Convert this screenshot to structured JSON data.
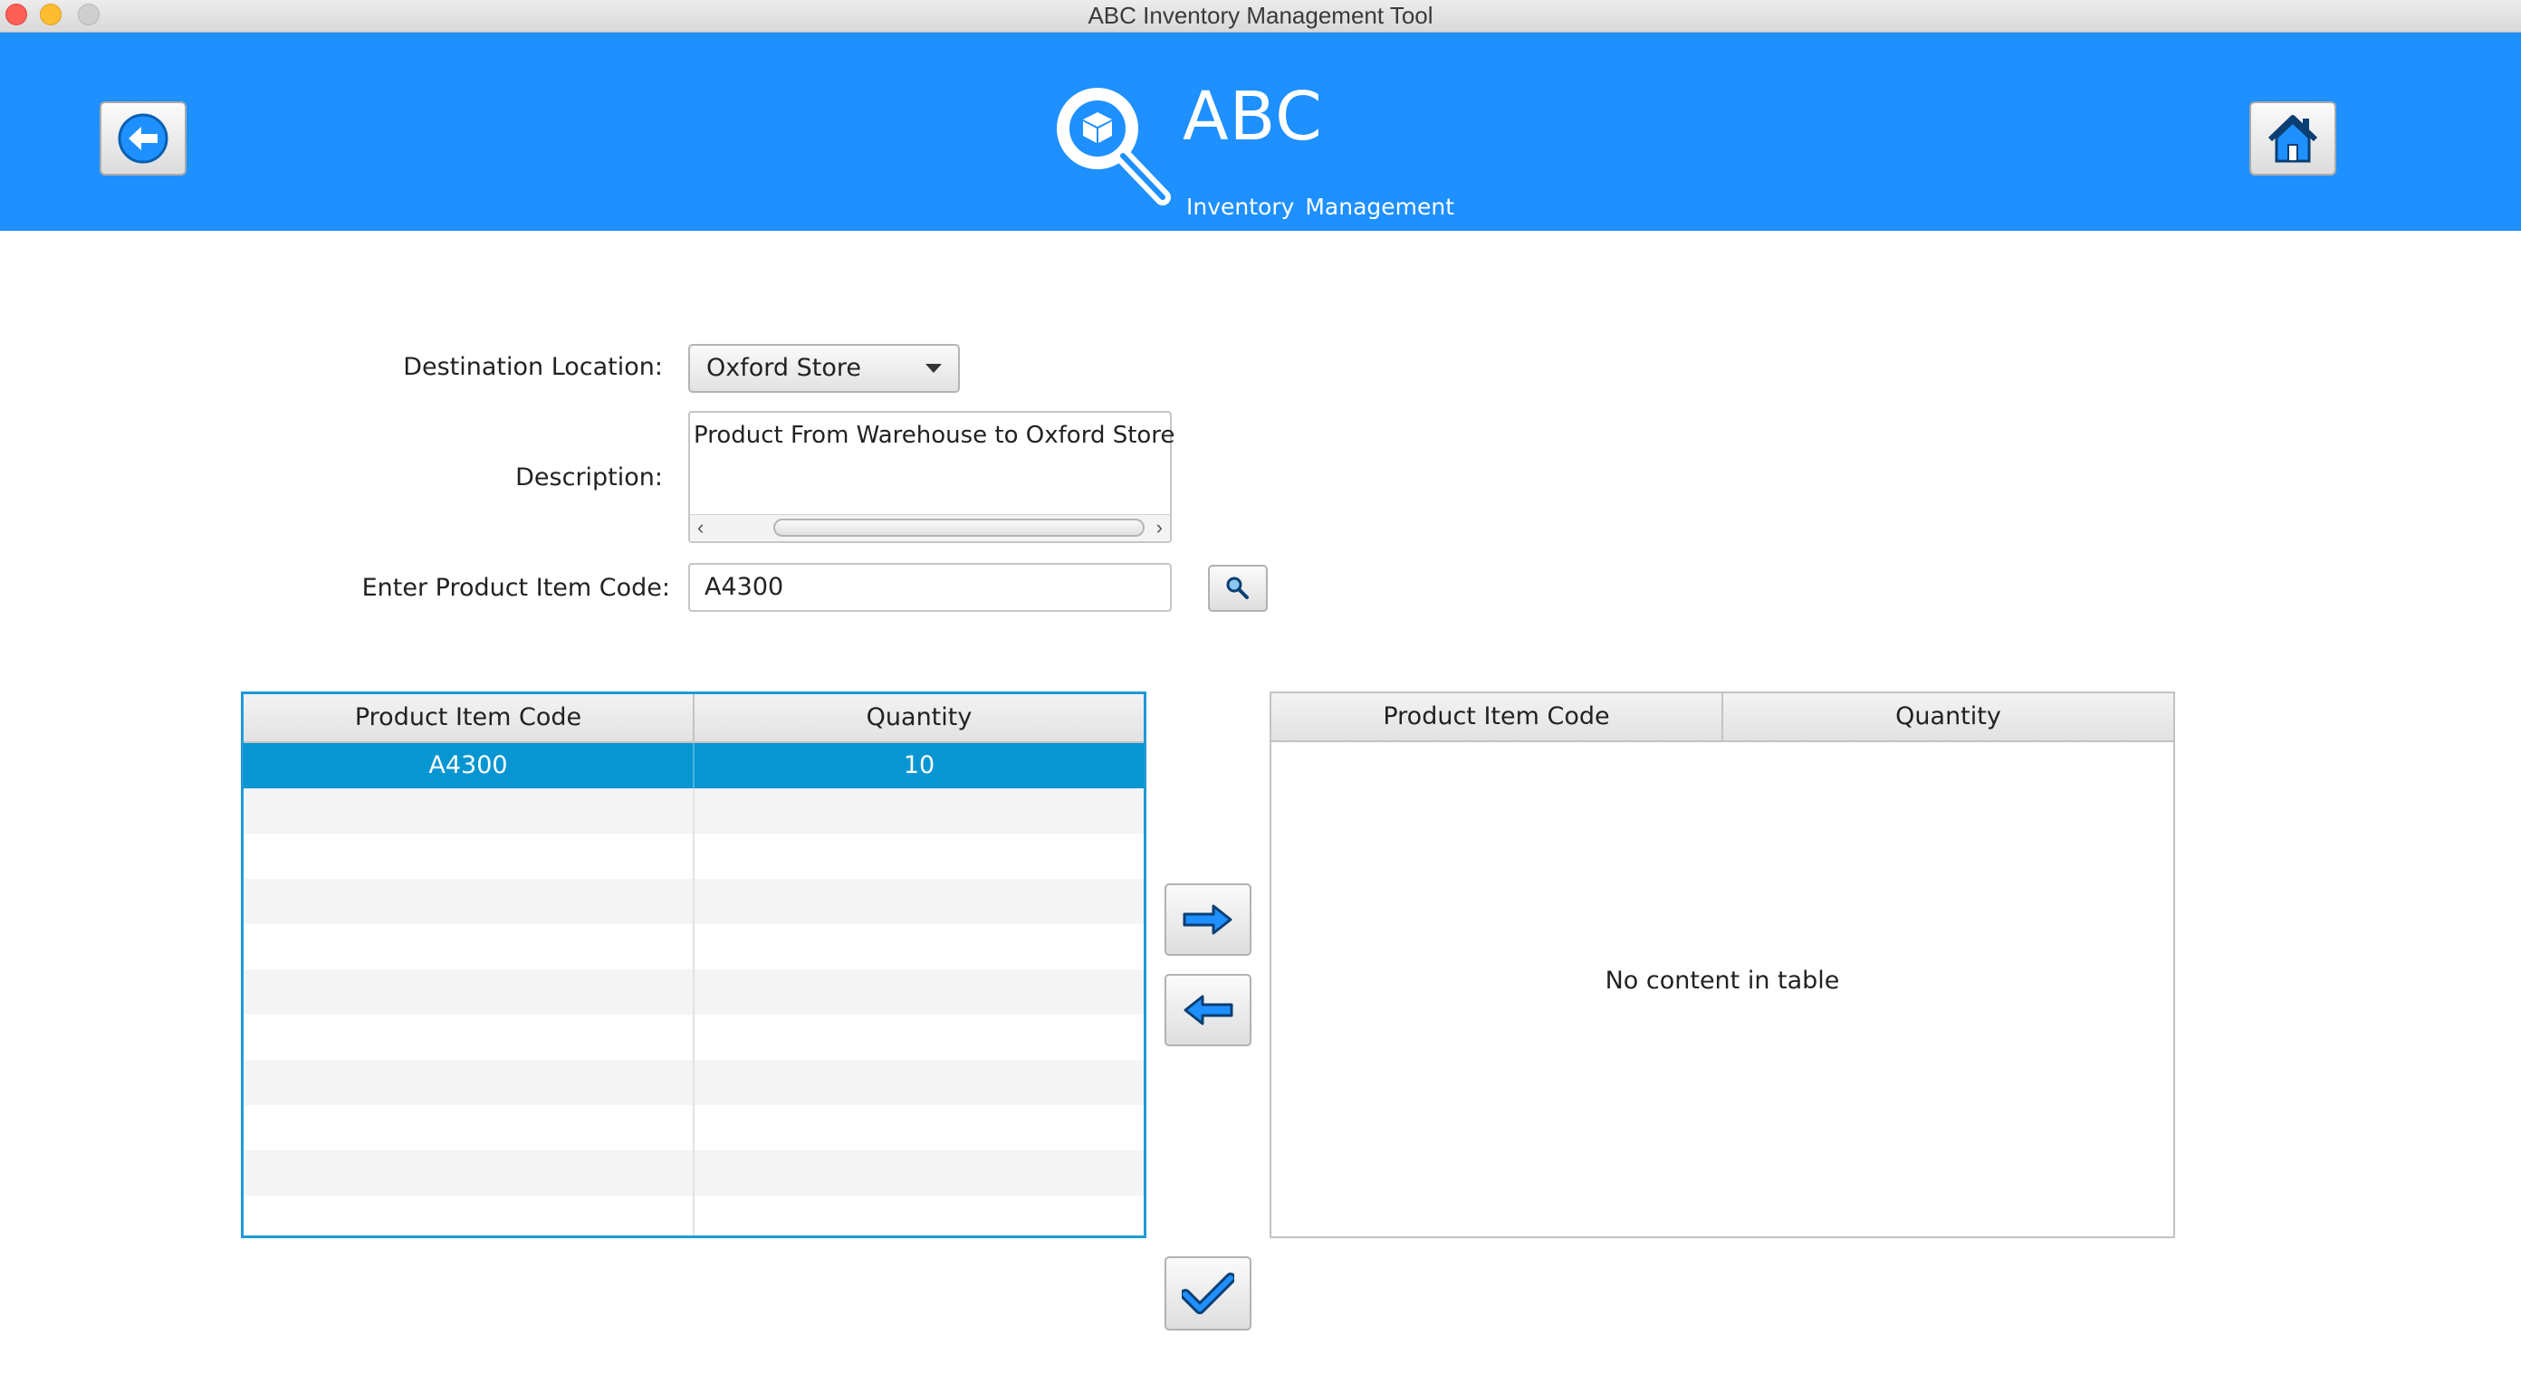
{
  "window": {
    "title": "ABC Inventory Management Tool"
  },
  "header": {
    "brand_title": "ABC",
    "brand_subtitle": "Inventory Management",
    "back_icon": "arrow-left-circle-icon",
    "home_icon": "home-icon",
    "logo_icon": "magnifier-box-icon",
    "accent_color": "#1e90ff"
  },
  "form": {
    "destination_label": "Destination Location:",
    "destination_value": "Oxford Store",
    "description_label": "Description:",
    "description_value": "Product From Warehouse to Oxford Store",
    "item_code_label": "Enter Product Item Code:",
    "item_code_value": "A4300",
    "search_icon": "search-icon"
  },
  "source_table": {
    "columns": [
      "Product Item Code",
      "Quantity"
    ],
    "rows": [
      {
        "code": "A4300",
        "quantity": "10",
        "selected": true
      }
    ]
  },
  "target_table": {
    "columns": [
      "Product Item Code",
      "Quantity"
    ],
    "rows": [],
    "empty_message": "No content in table"
  },
  "actions": {
    "move_right_icon": "arrow-right-icon",
    "move_left_icon": "arrow-left-icon",
    "confirm_icon": "checkmark-icon"
  }
}
